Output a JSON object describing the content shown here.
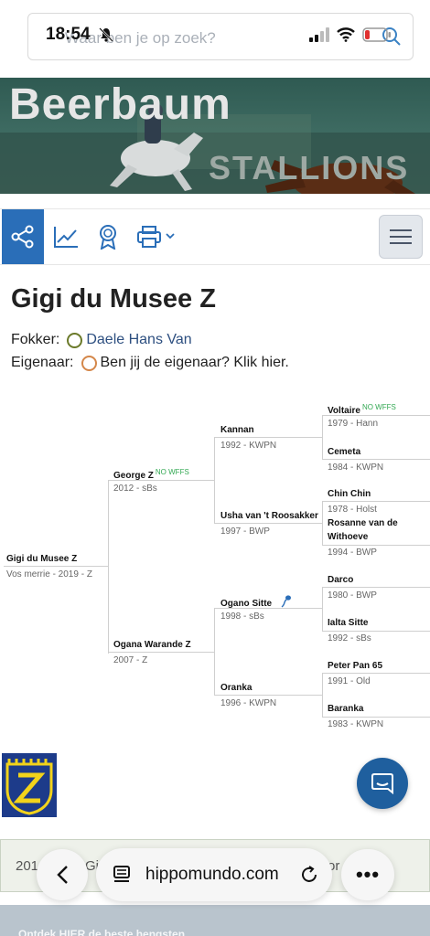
{
  "status": {
    "time": "18:54"
  },
  "search": {
    "placeholder": "Waar ben je op zoek?"
  },
  "banner": {
    "title": "Beerbaum",
    "subtitle": "STALLIONS"
  },
  "toolbar": {
    "icons": [
      "pedigree-icon",
      "chart-icon",
      "award-icon",
      "print-icon",
      "menu-icon"
    ]
  },
  "horse": {
    "name": "Gigi du Musee Z",
    "breeder_label": "Fokker:",
    "breeder": "Daele Hans Van",
    "owner_label": "Eigenaar:",
    "owner": "Ben jij de eigenaar? Klik hier."
  },
  "pedigree": {
    "subject": {
      "name": "Gigi du Musee Z",
      "info": "Vos merrie - 2019 - Z"
    },
    "sire": {
      "name": "George Z",
      "badge": "NO WFFS",
      "info": "2012 - sBs"
    },
    "dam": {
      "name": "Ogana Warande Z",
      "info": "2007 - Z"
    },
    "ss": {
      "name": "Kannan",
      "info": "1992 - KWPN"
    },
    "sd": {
      "name": "Usha van 't Roosakker",
      "info": "1997 - BWP"
    },
    "ds": {
      "name": "Ogano Sitte",
      "info": "1998 - sBs"
    },
    "dd": {
      "name": "Oranka",
      "info": "1996 - KWPN"
    },
    "sss": {
      "name": "Voltaire",
      "badge": "NO WFFS",
      "info": "1979 - Hann"
    },
    "ssd": {
      "name": "Cemeta",
      "info": "1984 - KWPN"
    },
    "sds": {
      "name": "Chin Chin",
      "info": "1978 - Holst"
    },
    "sdd": {
      "name": "Rosanne van de",
      "name2": "Withoeve",
      "info": "1994 - BWP"
    },
    "dss": {
      "name": "Darco",
      "info": "1980 - BWP"
    },
    "dsd": {
      "name": "Ialta Sitte",
      "info": "1992 - sBs"
    },
    "dds": {
      "name": "Peter Pan 65",
      "info": "1991 - Old"
    },
    "ddd": {
      "name": "Baranka",
      "info": "1983 - KWPN"
    }
  },
  "footer": {
    "card_left": "201",
    "card_mid": "Gi",
    "card_right": "or",
    "strip": "Ontdek HIER de beste hengsten"
  },
  "browser": {
    "url": "hippomundo.com",
    "more": "•••"
  }
}
